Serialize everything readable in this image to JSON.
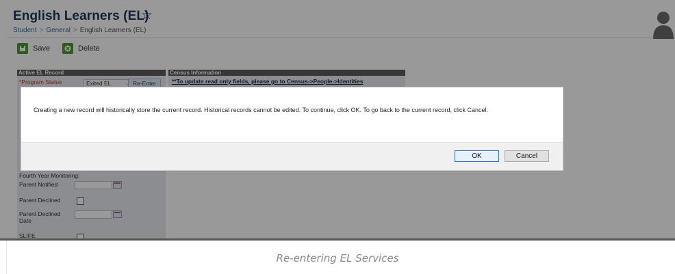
{
  "header": {
    "title": "English Learners (EL)",
    "breadcrumb": [
      "Student",
      "General",
      "English Learners (EL)"
    ],
    "breadcrumb_sep": ">"
  },
  "toolbar": {
    "save_label": "Save",
    "delete_label": "Delete"
  },
  "active_record": {
    "heading": "Active EL Record",
    "program_status_label": "*Program Status",
    "program_status_value": "Exited EL",
    "reenter_label": "Re-Enter",
    "fields": {
      "fourth_year": "Fourth Year Monitoring:",
      "parent_notified": "Parent Notified",
      "parent_declined": "Parent Declined",
      "parent_declined_date": "Parent Declined Date",
      "slife": "SLIFE"
    }
  },
  "census": {
    "heading": "Census Information",
    "link": "**To update read only fields, please go to Census->People->Identities"
  },
  "dialog": {
    "message": "Creating a new record will historically store the current record. Historical records cannot be edited. To continue, click OK. To go back to the current record, click Cancel.",
    "ok_label": "OK",
    "cancel_label": "Cancel"
  },
  "caption": "Re-entering EL Services",
  "colors": {
    "accent_green": "#4e9a2f",
    "title_navy": "#1e3a5a",
    "panel_header": "#5c5c5c",
    "required_red": "#c0392b"
  },
  "icons": [
    "star-icon",
    "avatar-icon",
    "save-icon",
    "delete-icon",
    "calendar-icon"
  ]
}
